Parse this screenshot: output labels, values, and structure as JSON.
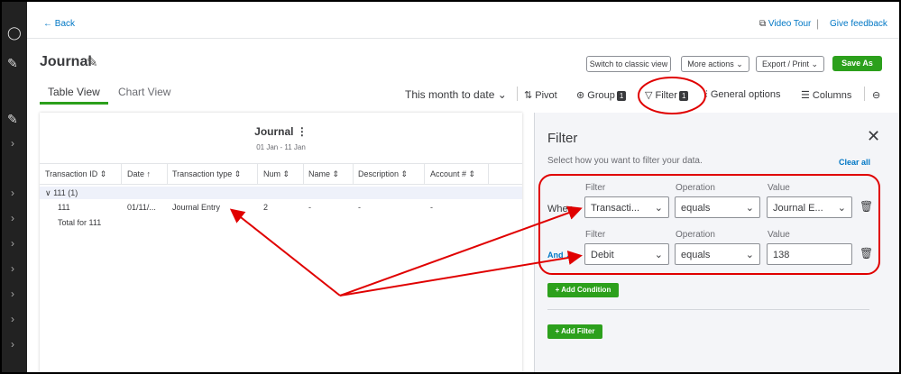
{
  "topbar": {
    "back_label": "Back",
    "video_tour": "Video Tour",
    "separator": "|",
    "give_feedback": "Give feedback"
  },
  "header": {
    "title": "Journal",
    "buttons": {
      "switch_classic": "Switch to classic view",
      "more_actions": "More actions",
      "export_print": "Export / Print",
      "save_as": "Save As"
    }
  },
  "tabs": {
    "table_view": "Table View",
    "chart_view": "Chart View"
  },
  "toolbar": {
    "date_range": "This month to date",
    "pivot": "Pivot",
    "group": "Group",
    "group_count": "1",
    "filter": "Filter",
    "filter_count": "1",
    "general_options": "General options",
    "columns": "Columns"
  },
  "report": {
    "title": "Journal",
    "date_range": "01 Jan - 11 Jan",
    "columns": [
      "Transaction ID",
      "Date",
      "Transaction type",
      "Num",
      "Name",
      "Description",
      "Account #"
    ],
    "sort_glyphs": [
      "⇕",
      "↑",
      "⇕",
      "⇕",
      "⇕",
      "⇕",
      "⇕"
    ],
    "group_row": "∨ 111 (1)",
    "rows": [
      {
        "id": "111",
        "date": "01/11/...",
        "type": "Journal Entry",
        "num": "2",
        "name": "-",
        "description": "-",
        "account": "-"
      }
    ],
    "total_label": "Total for 111"
  },
  "filter_panel": {
    "title": "Filter",
    "description": "Select how you want to filter your data.",
    "clear_all": "Clear all",
    "when_label": "When",
    "and_label": "And",
    "filter_label": "Filter",
    "operation_label": "Operation",
    "value_label": "Value",
    "conditions": [
      {
        "filter": "Transacti...",
        "operation": "equals",
        "value": "Journal E..."
      },
      {
        "filter": "Debit",
        "operation": "equals",
        "value": "138"
      }
    ],
    "add_condition": "+ Add Condition",
    "add_filter": "+ Add Filter"
  },
  "colors": {
    "accent_green": "#2ca01c",
    "link_blue": "#0077c5",
    "annotation_red": "#e00000"
  }
}
